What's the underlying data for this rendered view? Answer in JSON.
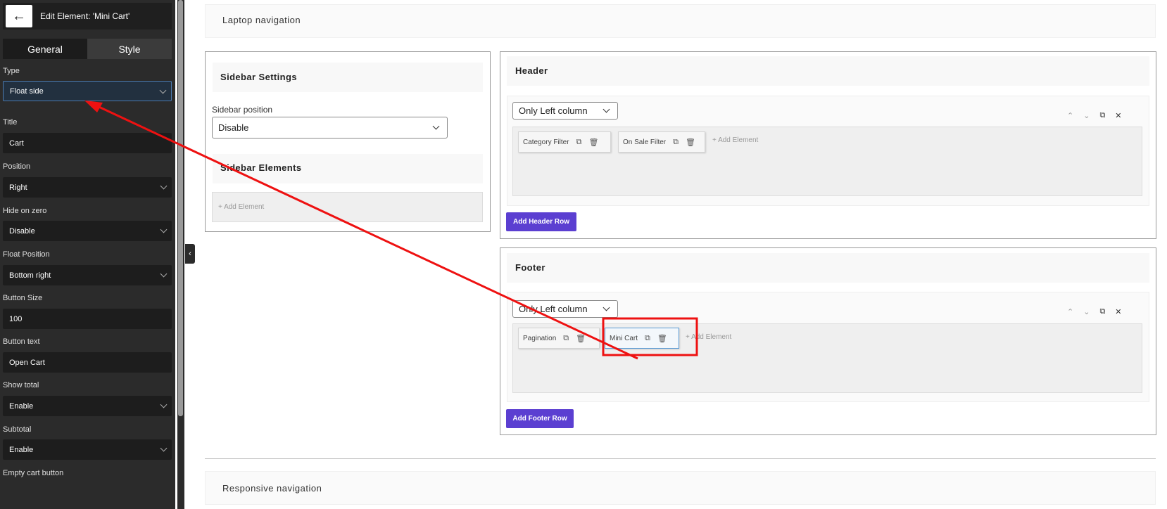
{
  "panel": {
    "title": "Edit Element: 'Mini Cart'",
    "back_icon": "←",
    "tabs": [
      "General",
      "Style"
    ],
    "fields": [
      {
        "label": "Type",
        "value": "Float side"
      },
      {
        "label": "Title",
        "value": "Cart"
      },
      {
        "label": "Position",
        "value": "Right"
      },
      {
        "label": "Hide on zero",
        "value": "Disable"
      },
      {
        "label": "Float Position",
        "value": "Bottom right"
      },
      {
        "label": "Button Size",
        "value": "100"
      },
      {
        "label": "Button text",
        "value": "Open Cart"
      },
      {
        "label": "Show total",
        "value": "Enable"
      },
      {
        "label": "Subtotal",
        "value": "Enable"
      },
      {
        "label": "Empty cart button",
        "value": ""
      }
    ],
    "collapse_icon": "‹"
  },
  "main": {
    "laptop_nav": "Laptop navigation",
    "responsive_nav": "Responsive navigation",
    "sidebar": {
      "settings_title": "Sidebar Settings",
      "position_label": "Sidebar position",
      "position_value": "Disable",
      "elements_title": "Sidebar Elements",
      "add_element": "+ Add Element"
    },
    "header": {
      "title": "Header",
      "column_select": "Only Left column",
      "chips": [
        "Category Filter",
        "On Sale Filter"
      ],
      "add_element": "+ Add Element",
      "add_row": "Add Header Row"
    },
    "footer": {
      "title": "Footer",
      "column_select": "Only Left column",
      "chips": [
        "Pagination",
        "Mini Cart"
      ],
      "add_element": "+ Add Element",
      "add_row": "Add Footer Row"
    },
    "icons": {
      "up": "⌃",
      "down": "⌄",
      "copy": "⧉",
      "close": "✕",
      "trash": "🗑"
    }
  }
}
